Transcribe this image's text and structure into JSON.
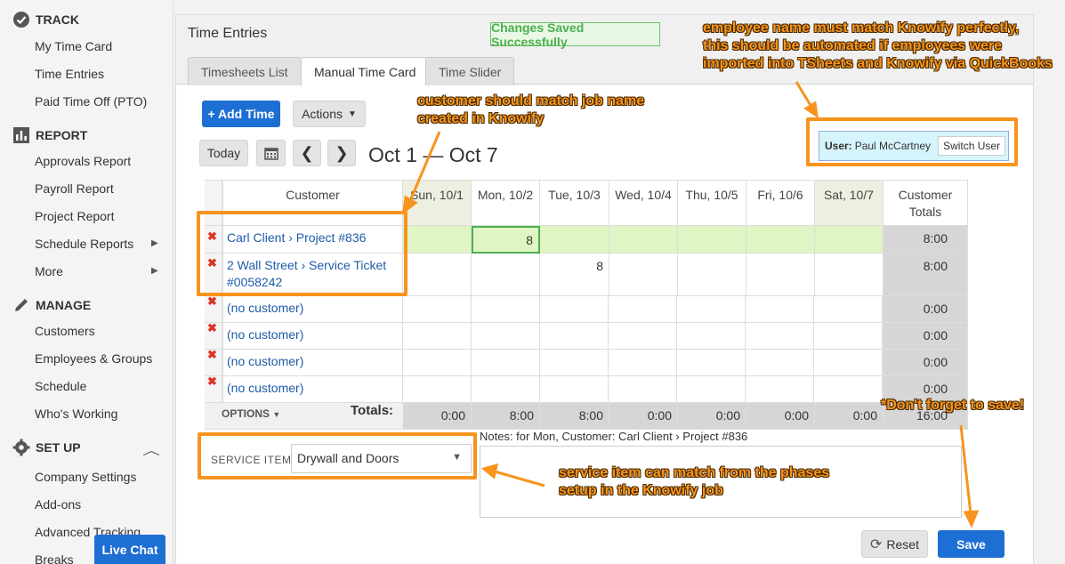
{
  "sidebar": {
    "track": {
      "title": "TRACK",
      "items": [
        "My Time Card",
        "Time Entries",
        "Paid Time Off (PTO)"
      ]
    },
    "report": {
      "title": "REPORT",
      "items": [
        "Approvals Report",
        "Payroll Report",
        "Project Report",
        "Schedule Reports",
        "More"
      ]
    },
    "manage": {
      "title": "MANAGE",
      "items": [
        "Customers",
        "Employees & Groups",
        "Schedule",
        "Who's Working"
      ]
    },
    "setup": {
      "title": "SET UP",
      "items": [
        "Company Settings",
        "Add-ons",
        "Advanced Tracking",
        "Breaks"
      ]
    },
    "live_chat": "Live Chat"
  },
  "panel": {
    "title": "Time Entries",
    "saved_message": "Changes Saved Successfully",
    "tabs": [
      "Timesheets List",
      "Manual Time Card",
      "Time Slider"
    ],
    "add_time": "+ Add Time",
    "actions": "Actions",
    "today": "Today",
    "date_range": "Oct 1 — Oct 7",
    "user_label": "User:",
    "user_name": "Paul McCartney",
    "switch_user": "Switch User"
  },
  "grid": {
    "customer_header": "Customer",
    "days": [
      "Sun, 10/1",
      "Mon, 10/2",
      "Tue, 10/3",
      "Wed, 10/4",
      "Thu, 10/5",
      "Fri, 10/6",
      "Sat, 10/7"
    ],
    "totals_header": "Customer Totals",
    "rows": [
      {
        "customer": "Carl Client › Project #836",
        "values": [
          "",
          "8",
          "",
          "",
          "",
          "",
          ""
        ],
        "total": "8:00"
      },
      {
        "customer": "2 Wall Street › Service Ticket #0058242",
        "values": [
          "",
          "",
          "8",
          "",
          "",
          "",
          ""
        ],
        "total": "8:00"
      },
      {
        "customer": "(no customer)",
        "values": [
          "",
          "",
          "",
          "",
          "",
          "",
          ""
        ],
        "total": "0:00"
      },
      {
        "customer": "(no customer)",
        "values": [
          "",
          "",
          "",
          "",
          "",
          "",
          ""
        ],
        "total": "0:00"
      },
      {
        "customer": "(no customer)",
        "values": [
          "",
          "",
          "",
          "",
          "",
          "",
          ""
        ],
        "total": "0:00"
      },
      {
        "customer": "(no customer)",
        "values": [
          "",
          "",
          "",
          "",
          "",
          "",
          ""
        ],
        "total": "0:00"
      }
    ],
    "options": "OPTIONS",
    "totals_label": "Totals:",
    "day_totals": [
      "0:00",
      "8:00",
      "8:00",
      "0:00",
      "0:00",
      "0:00",
      "0:00"
    ],
    "grand_total": "16:00"
  },
  "service": {
    "label": "SERVICE ITEM",
    "value": "Drywall and Doors",
    "notes_label": "Notes: for Mon, Customer: Carl Client › Project #836"
  },
  "buttons": {
    "reset": "Reset",
    "save": "Save"
  },
  "annotations": {
    "employee": [
      "employee name must match Knowify perfectly,",
      "this should be automated if employees were",
      "imported into TSheets and Knowify via QuickBooks"
    ],
    "customer": [
      "customer should match job name",
      "created in Knowify"
    ],
    "service": [
      "service item can match from the phases",
      "setup in the Knowify job"
    ],
    "save": "*Don't forget to save!"
  },
  "colors": {
    "accent": "#1e6fd4",
    "annotation": "#f7941d",
    "success": "#4caf50",
    "delete": "#dd3322"
  }
}
